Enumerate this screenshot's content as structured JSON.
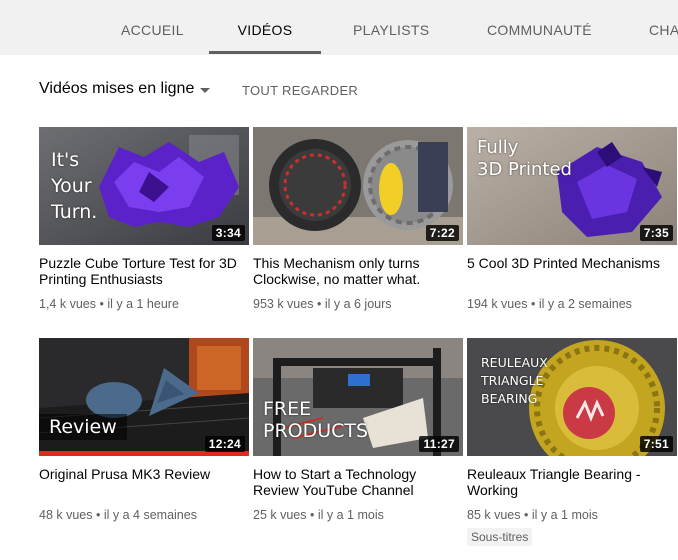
{
  "tabs": [
    {
      "label": "ACCUEIL",
      "active": false
    },
    {
      "label": "VIDÉOS",
      "active": true
    },
    {
      "label": "PLAYLISTS",
      "active": false
    },
    {
      "label": "COMMUNAUTÉ",
      "active": false
    },
    {
      "label": "CHA",
      "active": false
    }
  ],
  "sort": {
    "title": "Vidéos mises en ligne",
    "caret_icon": "caret-down-icon",
    "watch_all": "TOUT REGARDER"
  },
  "videos": [
    {
      "title": "Puzzle Cube Torture Test for 3D Printing Enthusiasts",
      "duration": "3:34",
      "views": "1,4 k vues",
      "age": "il y a 1 heure",
      "overlay": "It's\nYour\nTurn.",
      "badge": ""
    },
    {
      "title": "This Mechanism only turns Clockwise, no matter what.",
      "duration": "7:22",
      "views": "953 k vues",
      "age": "il y a 6 jours",
      "overlay": "",
      "badge": ""
    },
    {
      "title": "5 Cool 3D Printed Mechanisms",
      "duration": "7:35",
      "views": "194 k vues",
      "age": "il y a 2 semaines",
      "overlay": "Fully\n3D Printed",
      "badge": ""
    },
    {
      "title": "Original Prusa MK3 Review",
      "duration": "12:24",
      "views": "48 k vues",
      "age": "il y a 4 semaines",
      "overlay": "Review",
      "badge": ""
    },
    {
      "title": "How to Start a Technology Review YouTube Channel",
      "duration": "11:27",
      "views": "25 k vues",
      "age": "il y a 1 mois",
      "overlay": "FREE\nPRODUCTS",
      "badge": ""
    },
    {
      "title": "Reuleaux Triangle Bearing - Working",
      "duration": "7:51",
      "views": "85 k vues",
      "age": "il y a 1 mois",
      "overlay": "REULEAUX\nTRIANGLE\nBEARING",
      "badge": "Sous-titres"
    }
  ],
  "separator": "•"
}
